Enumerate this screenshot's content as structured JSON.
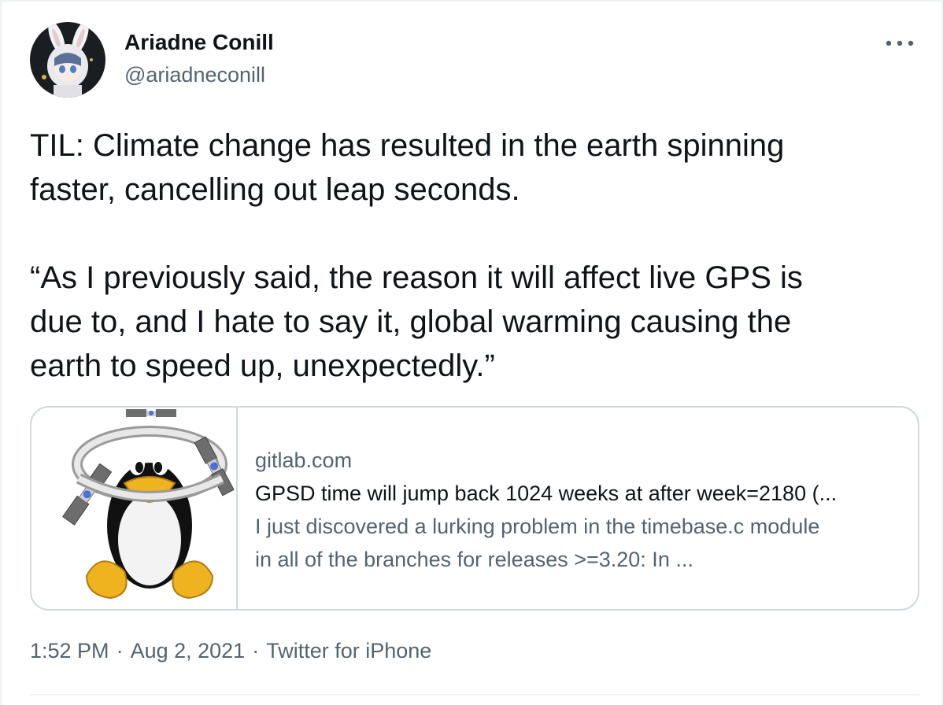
{
  "author": {
    "name": "Ariadne Conill",
    "handle": "@ariadneconill"
  },
  "more_button": {
    "label": "···"
  },
  "tweet": {
    "paragraph1_lines": [
      "TIL: Climate change has resulted in the earth spinning",
      "faster, cancelling out leap seconds."
    ],
    "paragraph2_lines": [
      "“As I previously said, the reason it will affect live GPS is",
      "due to, and I hate to say it, global warming causing the",
      "earth to speed up, unexpectedly.”"
    ]
  },
  "link_card": {
    "domain": "gitlab.com",
    "title": "GPSD time will jump back 1024 weeks at after week=2180 (...",
    "description_lines": [
      "I just discovered a lurking problem in the timebase.c module",
      "in all of the branches for releases >=3.20: In ..."
    ]
  },
  "meta": {
    "time": "1:52 PM",
    "separator": "·",
    "date": "Aug 2, 2021",
    "source": "Twitter for iPhone"
  },
  "colors": {
    "text_primary": "#0f1419",
    "text_secondary": "#536471",
    "border": "#cfd9de"
  }
}
